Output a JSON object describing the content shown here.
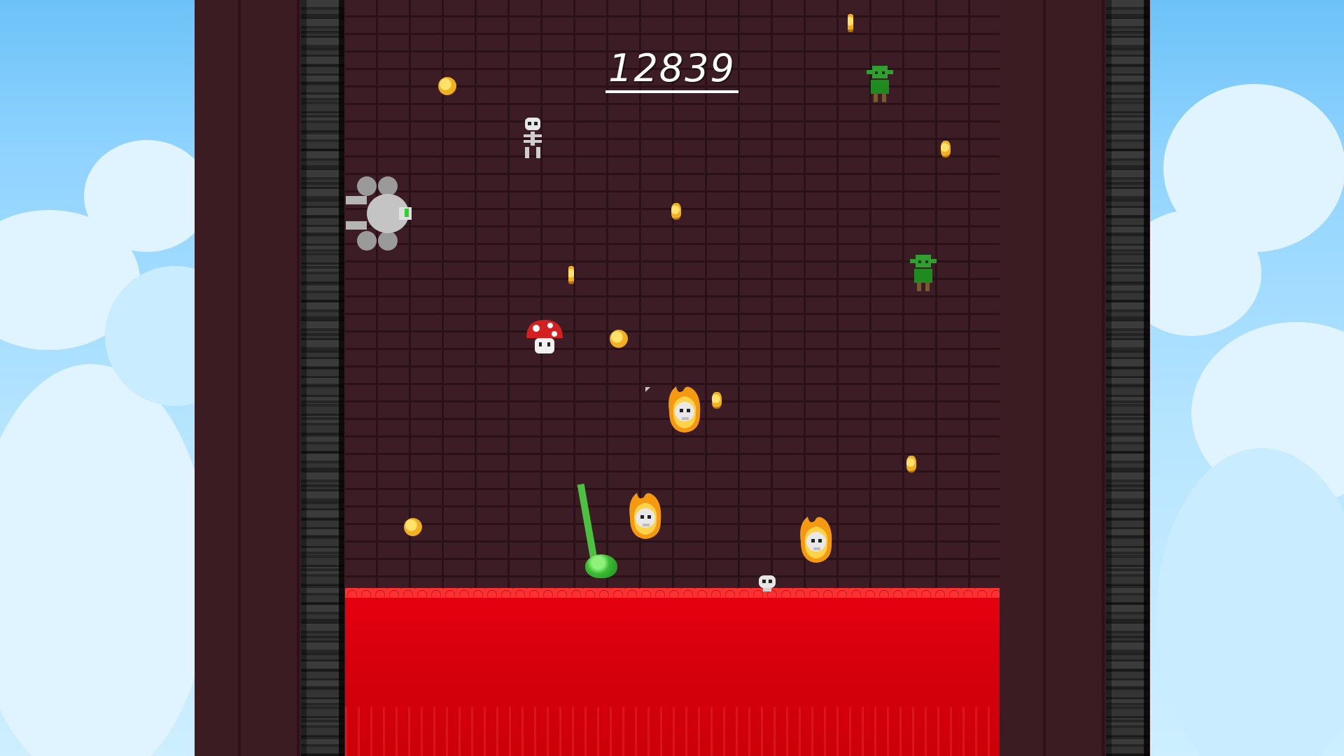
{
  "hud": {
    "score": "12839"
  },
  "colors": {
    "lava": "#e60010",
    "brick": "#3d1d25",
    "stone": "#6d6d6d",
    "sky": "#8fd3ff",
    "player": "#4cc040",
    "coin": "#f0b020"
  },
  "entities": {
    "coins": 10,
    "goblins": 2,
    "skeletons": 1,
    "flaming_skulls": 3,
    "mushroom": 1,
    "wall_crawler": 1,
    "ground_skull": 1
  },
  "icons": [
    "coin-icon",
    "goblin-icon",
    "skeleton-icon",
    "flaming-skull-icon",
    "mushroom-icon",
    "spider-crawler-icon",
    "skull-icon",
    "player-slime-icon"
  ]
}
